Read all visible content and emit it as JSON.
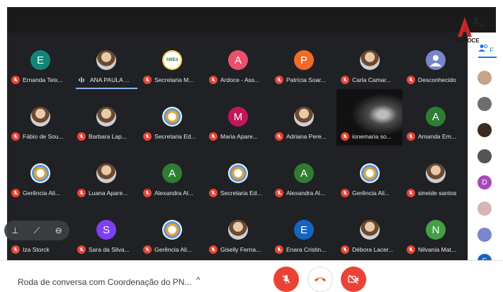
{
  "meeting": {
    "title": "Roda de conversa com Coordenação do PN...",
    "details_caret": "^"
  },
  "participants": [
    {
      "name": "Ernanda Teix...",
      "initial": "E",
      "color": "#12857b",
      "mic": "off"
    },
    {
      "name": "ANA PAULA ...",
      "initial": "",
      "color": "#5f6368",
      "mic": "speaking",
      "photo": true
    },
    {
      "name": "Secretaria M...",
      "initial": "",
      "color": "#ffffff",
      "mic": "off",
      "org": true,
      "badge": "SMEd"
    },
    {
      "name": "Ardoce - Ass...",
      "initial": "A",
      "color": "#e8506b",
      "mic": "off"
    },
    {
      "name": "Patrícia Soar...",
      "initial": "P",
      "color": "#f26b2a",
      "mic": "off"
    },
    {
      "name": "Carla Camar...",
      "initial": "",
      "color": "#5f6368",
      "mic": "off",
      "photo": true
    },
    {
      "name": "Desconhecido",
      "initial": "",
      "color": "#7986cb",
      "mic": "off",
      "unknown": true
    },
    {
      "name": "Fábio de Sou...",
      "initial": "",
      "color": "#5f6368",
      "mic": "off",
      "photo": true
    },
    {
      "name": "Barbara Lap...",
      "initial": "",
      "color": "#5f6368",
      "mic": "off",
      "photo": true
    },
    {
      "name": "Secretaria Ed...",
      "initial": "",
      "color": "#ffffff",
      "mic": "off",
      "org": true
    },
    {
      "name": "Maria Apare...",
      "initial": "M",
      "color": "#c2185b",
      "mic": "off"
    },
    {
      "name": "Adriana Pere...",
      "initial": "",
      "color": "#5f6368",
      "mic": "off",
      "photo": true
    },
    {
      "name": "ionemaria so...",
      "initial": "",
      "color": "#000000",
      "mic": "off",
      "video": true
    },
    {
      "name": "Amanda Em...",
      "initial": "A",
      "color": "#2e7d32",
      "mic": "off"
    },
    {
      "name": "Gerência Ali...",
      "initial": "",
      "color": "#ffffff",
      "mic": "off",
      "org": true
    },
    {
      "name": "Luana Apare...",
      "initial": "",
      "color": "#5f6368",
      "mic": "off",
      "photo": true
    },
    {
      "name": "Alexandra Al...",
      "initial": "A",
      "color": "#2e7d32",
      "mic": "off"
    },
    {
      "name": "Secretaria Ed...",
      "initial": "",
      "color": "#ffffff",
      "mic": "off",
      "org": true
    },
    {
      "name": "Alexandra Al...",
      "initial": "A",
      "color": "#2e7d32",
      "mic": "off"
    },
    {
      "name": "Gerência Ali...",
      "initial": "",
      "color": "#ffffff",
      "mic": "off",
      "org": true
    },
    {
      "name": "sineide santos",
      "initial": "",
      "color": "#5f6368",
      "mic": "off",
      "photo": true
    },
    {
      "name": "Iza Storck",
      "initial": "",
      "color": "#5f6368",
      "mic": "off",
      "hidden_avatar": true
    },
    {
      "name": "Sara da Silva...",
      "initial": "S",
      "color": "#7e3ff2",
      "mic": "off"
    },
    {
      "name": "Gerência Ali...",
      "initial": "",
      "color": "#ffffff",
      "mic": "off",
      "org": true
    },
    {
      "name": "Giselly Ferna...",
      "initial": "",
      "color": "#5f6368",
      "mic": "off",
      "photo": true
    },
    {
      "name": "Enara Cristin...",
      "initial": "E",
      "color": "#1565c0",
      "mic": "off"
    },
    {
      "name": "Débora Lacer...",
      "initial": "",
      "color": "#5f6368",
      "mic": "off",
      "photo": true
    },
    {
      "name": "Nilvania Mat...",
      "initial": "N",
      "color": "#43a047",
      "mic": "off"
    }
  ],
  "tile_controls": {
    "pin_icon": "pin-icon",
    "mute_icon": "mic-off-icon",
    "remove_icon": "remove-icon"
  },
  "side_panel": {
    "tab_label": "F",
    "avatars": [
      {
        "initial": "",
        "color": "#c7a38a"
      },
      {
        "initial": "",
        "color": "#6d6d6d"
      },
      {
        "initial": "",
        "color": "#3a2a22"
      },
      {
        "initial": "",
        "color": "#555555"
      },
      {
        "initial": "D",
        "color": "#ab47bc"
      },
      {
        "initial": "",
        "color": "#d8b4b4"
      },
      {
        "initial": "",
        "color": "#7986cb"
      },
      {
        "initial": "E",
        "color": "#1565c0"
      }
    ]
  },
  "logo": {
    "text": "ARDOCE",
    "superscript": "3",
    "suffix": "a"
  },
  "colors": {
    "grid_bg": "#202124",
    "mic_off": "#ea4335",
    "speaking": "#8ab4f8",
    "end_call": "#ea4335"
  }
}
